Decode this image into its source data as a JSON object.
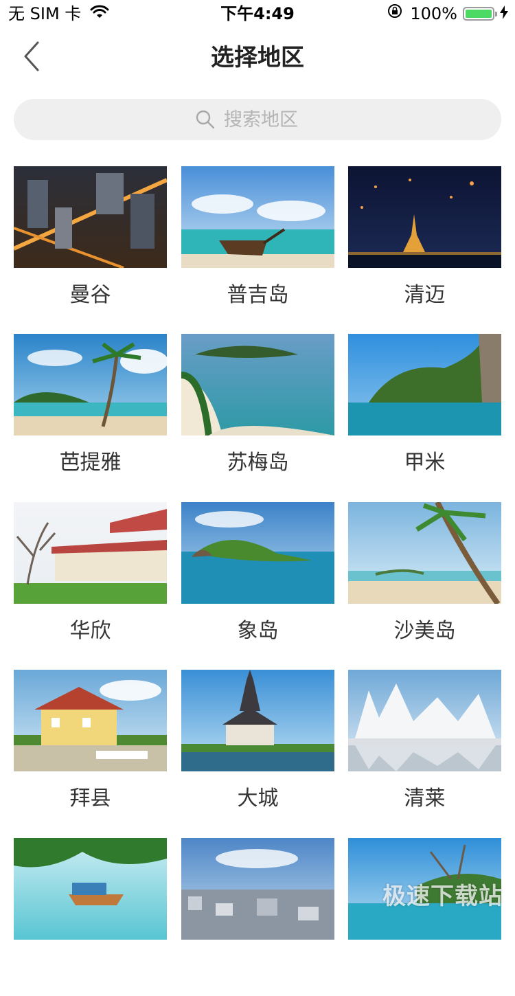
{
  "status_bar": {
    "carrier": "无 SIM 卡",
    "time": "下午4:49",
    "battery_percent": "100%",
    "battery_level": 1.0,
    "battery_color": "#4cd964"
  },
  "nav": {
    "title": "选择地区",
    "back_icon": "chevron-left-icon"
  },
  "search": {
    "placeholder": "搜索地区",
    "value": "",
    "icon": "search-icon"
  },
  "regions": [
    {
      "name": "曼谷"
    },
    {
      "name": "普吉岛"
    },
    {
      "name": "清迈"
    },
    {
      "name": "芭提雅"
    },
    {
      "name": "苏梅岛"
    },
    {
      "name": "甲米"
    },
    {
      "name": "华欣"
    },
    {
      "name": "象岛"
    },
    {
      "name": "沙美岛"
    },
    {
      "name": "拜县"
    },
    {
      "name": "大城"
    },
    {
      "name": "清莱"
    },
    {
      "name": ""
    },
    {
      "name": ""
    },
    {
      "name": ""
    }
  ],
  "watermark": "极速下载站"
}
